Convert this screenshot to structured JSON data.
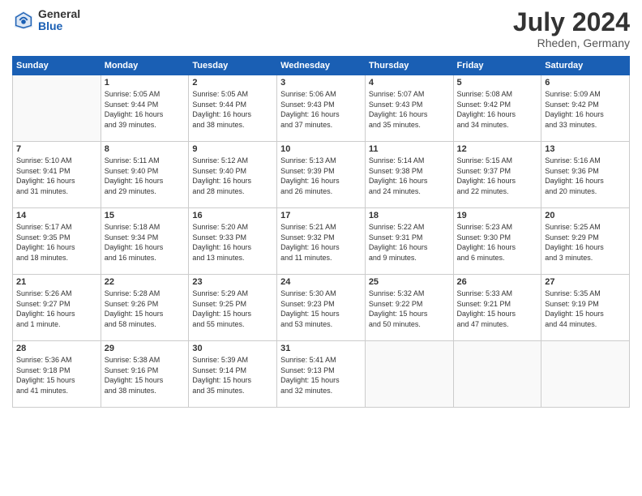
{
  "header": {
    "logo_general": "General",
    "logo_blue": "Blue",
    "month_year": "July 2024",
    "location": "Rheden, Germany"
  },
  "days_of_week": [
    "Sunday",
    "Monday",
    "Tuesday",
    "Wednesday",
    "Thursday",
    "Friday",
    "Saturday"
  ],
  "weeks": [
    [
      {
        "day": "",
        "info": ""
      },
      {
        "day": "1",
        "info": "Sunrise: 5:05 AM\nSunset: 9:44 PM\nDaylight: 16 hours\nand 39 minutes."
      },
      {
        "day": "2",
        "info": "Sunrise: 5:05 AM\nSunset: 9:44 PM\nDaylight: 16 hours\nand 38 minutes."
      },
      {
        "day": "3",
        "info": "Sunrise: 5:06 AM\nSunset: 9:43 PM\nDaylight: 16 hours\nand 37 minutes."
      },
      {
        "day": "4",
        "info": "Sunrise: 5:07 AM\nSunset: 9:43 PM\nDaylight: 16 hours\nand 35 minutes."
      },
      {
        "day": "5",
        "info": "Sunrise: 5:08 AM\nSunset: 9:42 PM\nDaylight: 16 hours\nand 34 minutes."
      },
      {
        "day": "6",
        "info": "Sunrise: 5:09 AM\nSunset: 9:42 PM\nDaylight: 16 hours\nand 33 minutes."
      }
    ],
    [
      {
        "day": "7",
        "info": "Sunrise: 5:10 AM\nSunset: 9:41 PM\nDaylight: 16 hours\nand 31 minutes."
      },
      {
        "day": "8",
        "info": "Sunrise: 5:11 AM\nSunset: 9:40 PM\nDaylight: 16 hours\nand 29 minutes."
      },
      {
        "day": "9",
        "info": "Sunrise: 5:12 AM\nSunset: 9:40 PM\nDaylight: 16 hours\nand 28 minutes."
      },
      {
        "day": "10",
        "info": "Sunrise: 5:13 AM\nSunset: 9:39 PM\nDaylight: 16 hours\nand 26 minutes."
      },
      {
        "day": "11",
        "info": "Sunrise: 5:14 AM\nSunset: 9:38 PM\nDaylight: 16 hours\nand 24 minutes."
      },
      {
        "day": "12",
        "info": "Sunrise: 5:15 AM\nSunset: 9:37 PM\nDaylight: 16 hours\nand 22 minutes."
      },
      {
        "day": "13",
        "info": "Sunrise: 5:16 AM\nSunset: 9:36 PM\nDaylight: 16 hours\nand 20 minutes."
      }
    ],
    [
      {
        "day": "14",
        "info": "Sunrise: 5:17 AM\nSunset: 9:35 PM\nDaylight: 16 hours\nand 18 minutes."
      },
      {
        "day": "15",
        "info": "Sunrise: 5:18 AM\nSunset: 9:34 PM\nDaylight: 16 hours\nand 16 minutes."
      },
      {
        "day": "16",
        "info": "Sunrise: 5:20 AM\nSunset: 9:33 PM\nDaylight: 16 hours\nand 13 minutes."
      },
      {
        "day": "17",
        "info": "Sunrise: 5:21 AM\nSunset: 9:32 PM\nDaylight: 16 hours\nand 11 minutes."
      },
      {
        "day": "18",
        "info": "Sunrise: 5:22 AM\nSunset: 9:31 PM\nDaylight: 16 hours\nand 9 minutes."
      },
      {
        "day": "19",
        "info": "Sunrise: 5:23 AM\nSunset: 9:30 PM\nDaylight: 16 hours\nand 6 minutes."
      },
      {
        "day": "20",
        "info": "Sunrise: 5:25 AM\nSunset: 9:29 PM\nDaylight: 16 hours\nand 3 minutes."
      }
    ],
    [
      {
        "day": "21",
        "info": "Sunrise: 5:26 AM\nSunset: 9:27 PM\nDaylight: 16 hours\nand 1 minute."
      },
      {
        "day": "22",
        "info": "Sunrise: 5:28 AM\nSunset: 9:26 PM\nDaylight: 15 hours\nand 58 minutes."
      },
      {
        "day": "23",
        "info": "Sunrise: 5:29 AM\nSunset: 9:25 PM\nDaylight: 15 hours\nand 55 minutes."
      },
      {
        "day": "24",
        "info": "Sunrise: 5:30 AM\nSunset: 9:23 PM\nDaylight: 15 hours\nand 53 minutes."
      },
      {
        "day": "25",
        "info": "Sunrise: 5:32 AM\nSunset: 9:22 PM\nDaylight: 15 hours\nand 50 minutes."
      },
      {
        "day": "26",
        "info": "Sunrise: 5:33 AM\nSunset: 9:21 PM\nDaylight: 15 hours\nand 47 minutes."
      },
      {
        "day": "27",
        "info": "Sunrise: 5:35 AM\nSunset: 9:19 PM\nDaylight: 15 hours\nand 44 minutes."
      }
    ],
    [
      {
        "day": "28",
        "info": "Sunrise: 5:36 AM\nSunset: 9:18 PM\nDaylight: 15 hours\nand 41 minutes."
      },
      {
        "day": "29",
        "info": "Sunrise: 5:38 AM\nSunset: 9:16 PM\nDaylight: 15 hours\nand 38 minutes."
      },
      {
        "day": "30",
        "info": "Sunrise: 5:39 AM\nSunset: 9:14 PM\nDaylight: 15 hours\nand 35 minutes."
      },
      {
        "day": "31",
        "info": "Sunrise: 5:41 AM\nSunset: 9:13 PM\nDaylight: 15 hours\nand 32 minutes."
      },
      {
        "day": "",
        "info": ""
      },
      {
        "day": "",
        "info": ""
      },
      {
        "day": "",
        "info": ""
      }
    ]
  ]
}
